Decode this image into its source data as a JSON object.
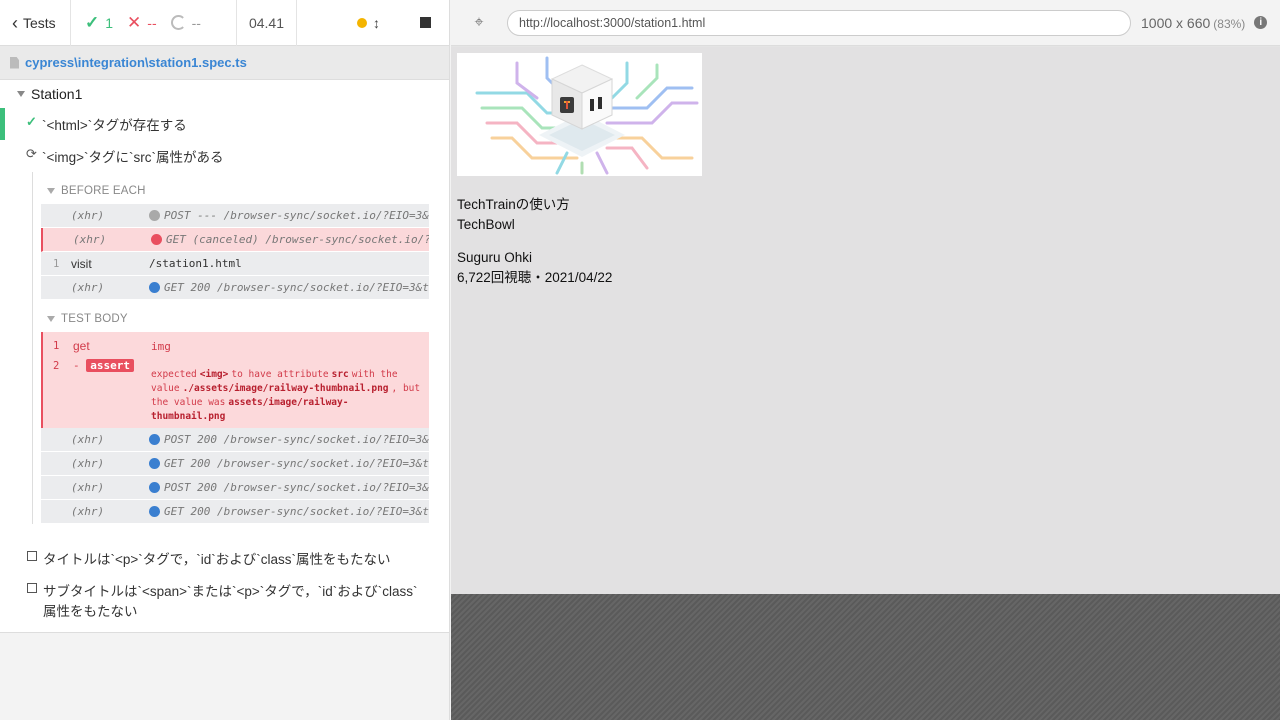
{
  "topbar": {
    "tests_label": "Tests",
    "passed": "1",
    "failed": "--",
    "pending": "--",
    "duration": "04.41"
  },
  "spec": {
    "path": "cypress\\integration\\station1.spec.ts"
  },
  "suite": {
    "title": "Station1",
    "tests": [
      {
        "title": "`<html>`タグが存在する",
        "state": "passed"
      },
      {
        "title": "`<img>`タグに`src`属性がある",
        "state": "running"
      },
      {
        "title": "タイトルは`<p>`タグで，`id`および`class`属性をもたない",
        "state": "pending"
      },
      {
        "title": "サブタイトルは`<span>`または`<p>`タグで，`id`および`class`",
        "title2": "属性をもたない",
        "state": "pending"
      }
    ]
  },
  "before_each": {
    "label": "BEFORE EACH",
    "commands": [
      {
        "num": "",
        "name": "(xhr)",
        "msg": "POST --- /browser-sync/socket.io/?EIO=3&transport=polling",
        "bullet": "grey",
        "state": "normal"
      },
      {
        "num": "",
        "name": "(xhr)",
        "msg": "GET (canceled) /browser-sync/socket.io/?EIO=3",
        "bullet": "red",
        "state": "failed"
      },
      {
        "num": "1",
        "name": "visit",
        "msg": "/station1.html",
        "bullet": "",
        "state": "plain"
      },
      {
        "num": "",
        "name": "(xhr)",
        "msg": "GET 200 /browser-sync/socket.io/?EIO=3&transport=polling",
        "bullet": "blue",
        "state": "normal"
      }
    ]
  },
  "test_body": {
    "label": "TEST BODY",
    "get_num": "1",
    "get_name": "get",
    "get_msg": "img",
    "assert_num": "2",
    "assert_dash": "-",
    "assert_label": "assert",
    "fail_msg": {
      "p1": "expected",
      "t1": "<img>",
      "p2": "to have attribute",
      "t2": "src",
      "p3": "with the value",
      "t3": "./assets/image/railway-thumbnail.png",
      "p4": ", but the value was",
      "t4": "assets/image/railway-thumbnail.png"
    },
    "commands": [
      {
        "num": "",
        "name": "(xhr)",
        "msg": "POST 200 /browser-sync/socket.io/?EIO=3&transport=polling",
        "bullet": "blue"
      },
      {
        "num": "",
        "name": "(xhr)",
        "msg": "GET 200 /browser-sync/socket.io/?EIO=3&transport=polling",
        "bullet": "blue"
      },
      {
        "num": "",
        "name": "(xhr)",
        "msg": "POST 200 /browser-sync/socket.io/?EIO=3&transport=polling",
        "bullet": "blue"
      },
      {
        "num": "",
        "name": "(xhr)",
        "msg": "GET 200 /browser-sync/socket.io/?EIO=3&transport=polling",
        "bullet": "blue"
      }
    ]
  },
  "aut": {
    "url": "http://localhost:3000/station1.html",
    "viewport": "1000 x 660",
    "scale": "(83%)",
    "title": "TechTrainの使い方",
    "channel": "TechBowl",
    "author": "Suguru Ohki",
    "meta": "6,722回視聴・2021/04/22"
  },
  "colors": {
    "pass": "#3cbf7b",
    "fail": "#e94f5f",
    "link": "#3a86d4",
    "xhr": "#3a7fd0"
  }
}
